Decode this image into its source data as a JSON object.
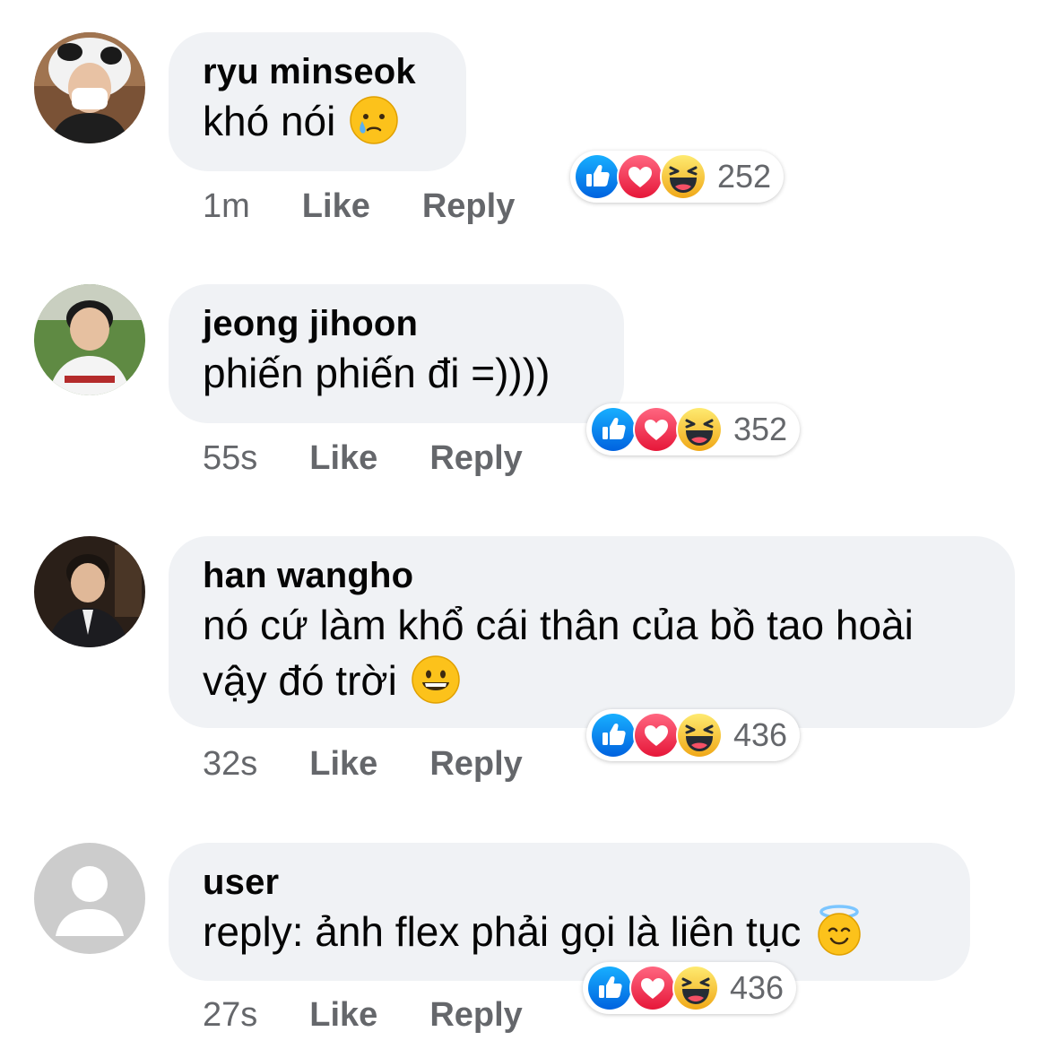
{
  "comments": [
    {
      "author": "ryu minseok",
      "text": "khó nói",
      "emoji": "crying-face-emoji",
      "time": "1m",
      "like_label": "Like",
      "reply_label": "Reply",
      "reaction_count": "252",
      "reactions": [
        "like-reaction-icon",
        "love-reaction-icon",
        "haha-reaction-icon"
      ]
    },
    {
      "author": "jeong jihoon",
      "text": "phiến phiến đi =))))",
      "time": "55s",
      "like_label": "Like",
      "reply_label": "Reply",
      "reaction_count": "352",
      "reactions": [
        "like-reaction-icon",
        "love-reaction-icon",
        "haha-reaction-icon"
      ]
    },
    {
      "author": "han wangho",
      "text": "nó cứ làm khổ cái thân của bồ tao hoài vậy đó trời",
      "emoji": "grinning-face-emoji",
      "time": "32s",
      "like_label": "Like",
      "reply_label": "Reply",
      "reaction_count": "436",
      "reactions": [
        "like-reaction-icon",
        "love-reaction-icon",
        "haha-reaction-icon"
      ]
    },
    {
      "author": "user",
      "text": "reply: ảnh flex phải gọi là liên tục",
      "emoji": "smiling-face-with-halo-emoji",
      "time": "27s",
      "like_label": "Like",
      "reply_label": "Reply",
      "reaction_count": "436",
      "reactions": [
        "like-reaction-icon",
        "love-reaction-icon",
        "haha-reaction-icon"
      ]
    }
  ],
  "colors": {
    "bubble_bg": "#f0f2f5",
    "text_primary": "#050505",
    "text_secondary": "#65676b",
    "like_blue": "#1877f2",
    "love_red": "#f33e58",
    "haha_yellow": "#f7b125"
  }
}
